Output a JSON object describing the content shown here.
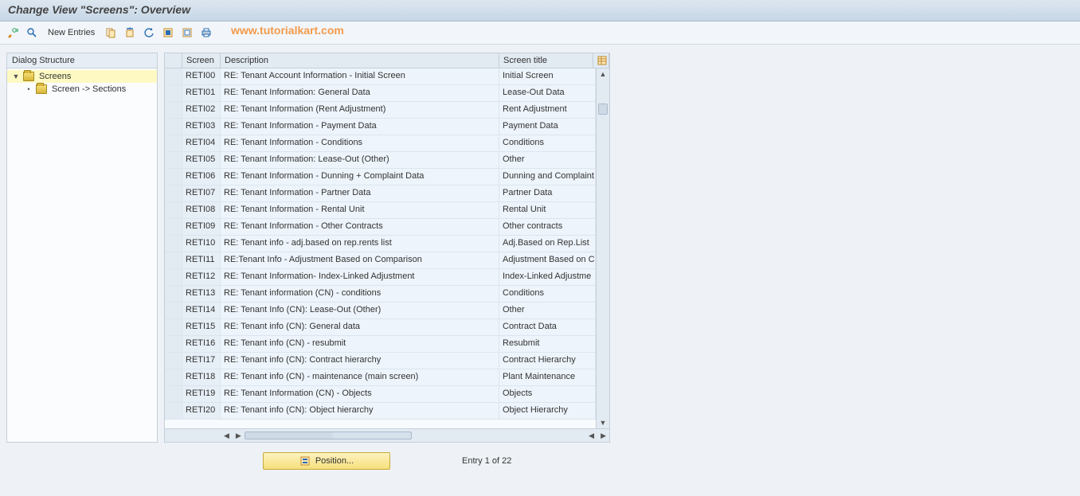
{
  "title": "Change View \"Screens\": Overview",
  "watermark": "www.tutorialkart.com",
  "toolbar": {
    "new_entries_label": "New Entries"
  },
  "tree": {
    "header": "Dialog Structure",
    "items": [
      {
        "label": "Screens",
        "selected": true,
        "expanded": true,
        "level": 0
      },
      {
        "label": "Screen -> Sections",
        "selected": false,
        "expanded": false,
        "level": 1
      }
    ]
  },
  "table": {
    "headers": {
      "screen": "Screen",
      "description": "Description",
      "screen_title": "Screen title"
    },
    "rows": [
      {
        "screen": "RETI00",
        "description": "RE: Tenant Account Information - Initial Screen",
        "title": "Initial Screen"
      },
      {
        "screen": "RETI01",
        "description": "RE: Tenant Information: General Data",
        "title": "Lease-Out Data"
      },
      {
        "screen": "RETI02",
        "description": "RE: Tenant Information (Rent Adjustment)",
        "title": "Rent Adjustment"
      },
      {
        "screen": "RETI03",
        "description": "RE: Tenant Information - Payment Data",
        "title": "Payment Data"
      },
      {
        "screen": "RETI04",
        "description": "RE: Tenant Information - Conditions",
        "title": "Conditions"
      },
      {
        "screen": "RETI05",
        "description": "RE: Tenant Information: Lease-Out (Other)",
        "title": "Other"
      },
      {
        "screen": "RETI06",
        "description": "RE: Tenant Information - Dunning + Complaint Data",
        "title": "Dunning and Complaint"
      },
      {
        "screen": "RETI07",
        "description": "RE: Tenant Information - Partner Data",
        "title": "Partner Data"
      },
      {
        "screen": "RETI08",
        "description": "RE: Tenant Information - Rental Unit",
        "title": "Rental Unit"
      },
      {
        "screen": "RETI09",
        "description": "RE: Tenant Information - Other Contracts",
        "title": "Other contracts"
      },
      {
        "screen": "RETI10",
        "description": "RE: Tenant info - adj.based on rep.rents list",
        "title": "Adj.Based on Rep.List"
      },
      {
        "screen": "RETI11",
        "description": "RE:Tenant Info - Adjustment Based on Comparison",
        "title": "Adjustment Based on C"
      },
      {
        "screen": "RETI12",
        "description": "RE: Tenant Information- Index-Linked Adjustment",
        "title": "Index-Linked Adjustme"
      },
      {
        "screen": "RETI13",
        "description": "RE: Tenant information (CN) - conditions",
        "title": "Conditions"
      },
      {
        "screen": "RETI14",
        "description": "RE: Tenant Info (CN): Lease-Out (Other)",
        "title": "Other"
      },
      {
        "screen": "RETI15",
        "description": "RE: Tenant info (CN): General data",
        "title": "Contract Data"
      },
      {
        "screen": "RETI16",
        "description": "RE: Tenant info (CN) - resubmit",
        "title": "Resubmit"
      },
      {
        "screen": "RETI17",
        "description": "RE: Tenant info (CN): Contract hierarchy",
        "title": "Contract Hierarchy"
      },
      {
        "screen": "RETI18",
        "description": "RE: Tenant info (CN) - maintenance (main screen)",
        "title": "Plant Maintenance"
      },
      {
        "screen": "RETI19",
        "description": "RE: Tenant Information (CN) - Objects",
        "title": "Objects"
      },
      {
        "screen": "RETI20",
        "description": "RE: Tenant info (CN): Object hierarchy",
        "title": "Object Hierarchy"
      }
    ]
  },
  "footer": {
    "position_label": "Position...",
    "entry_label": "Entry 1 of 22"
  }
}
